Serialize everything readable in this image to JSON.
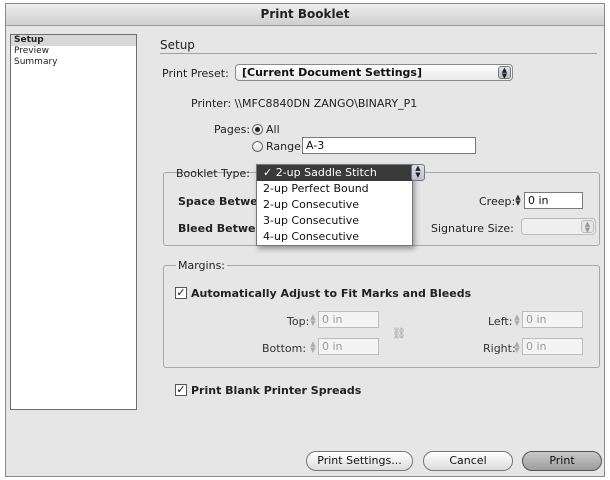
{
  "window": {
    "title": "Print Booklet"
  },
  "sidebar": {
    "items": [
      {
        "label": "Setup",
        "active": true
      },
      {
        "label": "Preview",
        "active": false
      },
      {
        "label": "Summary",
        "active": false
      }
    ]
  },
  "setup": {
    "section_title": "Setup",
    "print_preset": {
      "label": "Print Preset:",
      "value": "[Current Document Settings]"
    },
    "printer": {
      "text": "Printer: \\\\MFC8840DN ZANGO\\BINARY_P1"
    },
    "pages": {
      "label": "Pages:",
      "all_label": "All",
      "range_label": "Range:",
      "range_value": "A-3"
    },
    "booklet_type": {
      "label": "Booklet Type:",
      "options": [
        "✓ 2-up Saddle Stitch",
        "2-up Perfect Bound",
        "2-up Consecutive",
        "3-up Consecutive",
        "4-up Consecutive"
      ]
    },
    "space_between_label": "Space Between",
    "bleed_between_label": "Bleed Between",
    "creep": {
      "label": "Creep:",
      "value": "0 in"
    },
    "signature_size": {
      "label": "Signature Size:",
      "value": ""
    }
  },
  "margins": {
    "group_label": "Margins:",
    "auto_adjust_label": "Automatically Adjust to Fit Marks and Bleeds",
    "top": {
      "label": "Top:",
      "value": "0 in"
    },
    "bottom": {
      "label": "Bottom:",
      "value": "0 in"
    },
    "left": {
      "label": "Left:",
      "value": "0 in"
    },
    "right": {
      "label": "Right:",
      "value": "0 in"
    }
  },
  "print_blank_label": "Print Blank Printer Spreads",
  "buttons": {
    "print_settings": "Print Settings...",
    "cancel": "Cancel",
    "print": "Print"
  },
  "icons": {
    "check": "✓",
    "stepper": "▲▼",
    "link": "chain-link-icon"
  }
}
